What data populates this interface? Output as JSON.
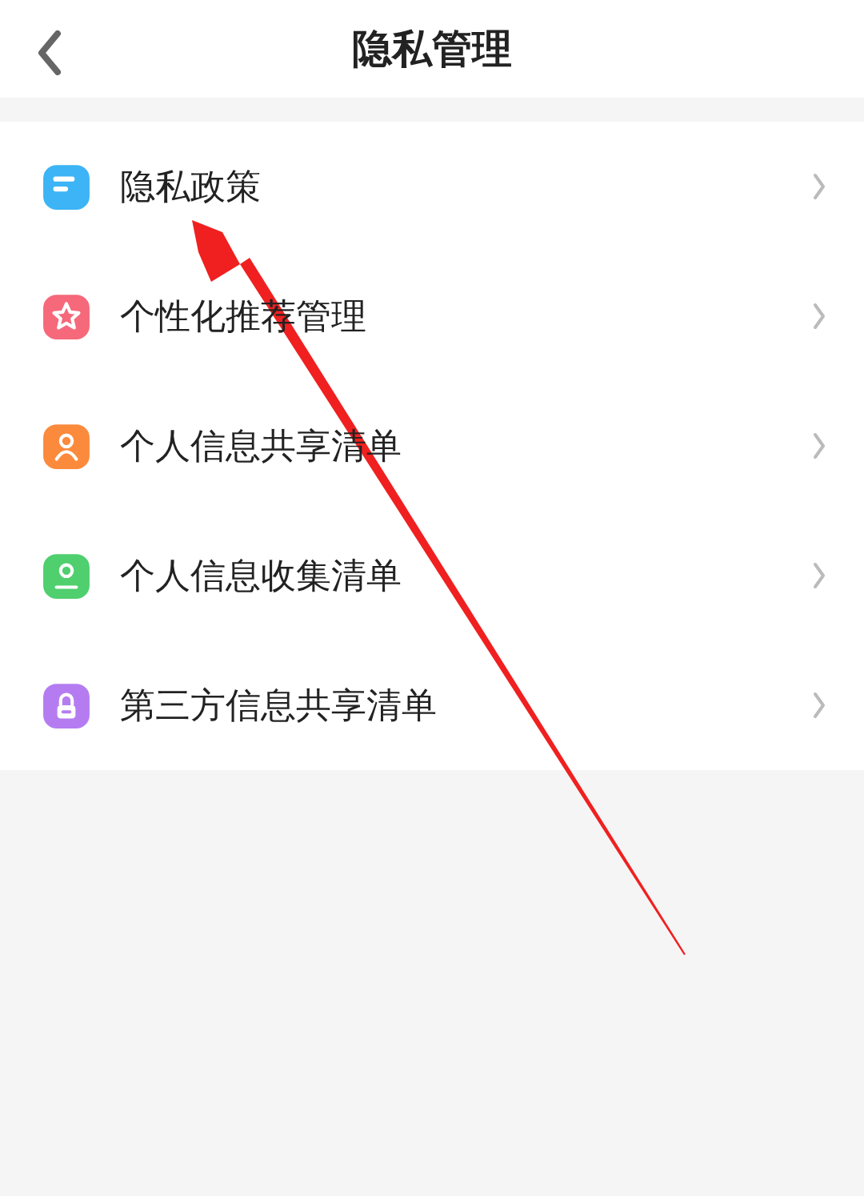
{
  "header": {
    "title": "隐私管理"
  },
  "items": [
    {
      "label": "隐私政策",
      "kind": "document",
      "color": "#3cb4f5"
    },
    {
      "label": "个性化推荐管理",
      "kind": "star",
      "color": "#f5697a"
    },
    {
      "label": "个人信息共享清单",
      "kind": "person",
      "color": "#fb8a3c"
    },
    {
      "label": "个人信息收集清单",
      "kind": "profile",
      "color": "#4fcf6e"
    },
    {
      "label": "第三方信息共享清单",
      "kind": "lock",
      "color": "#b57cf2"
    }
  ]
}
